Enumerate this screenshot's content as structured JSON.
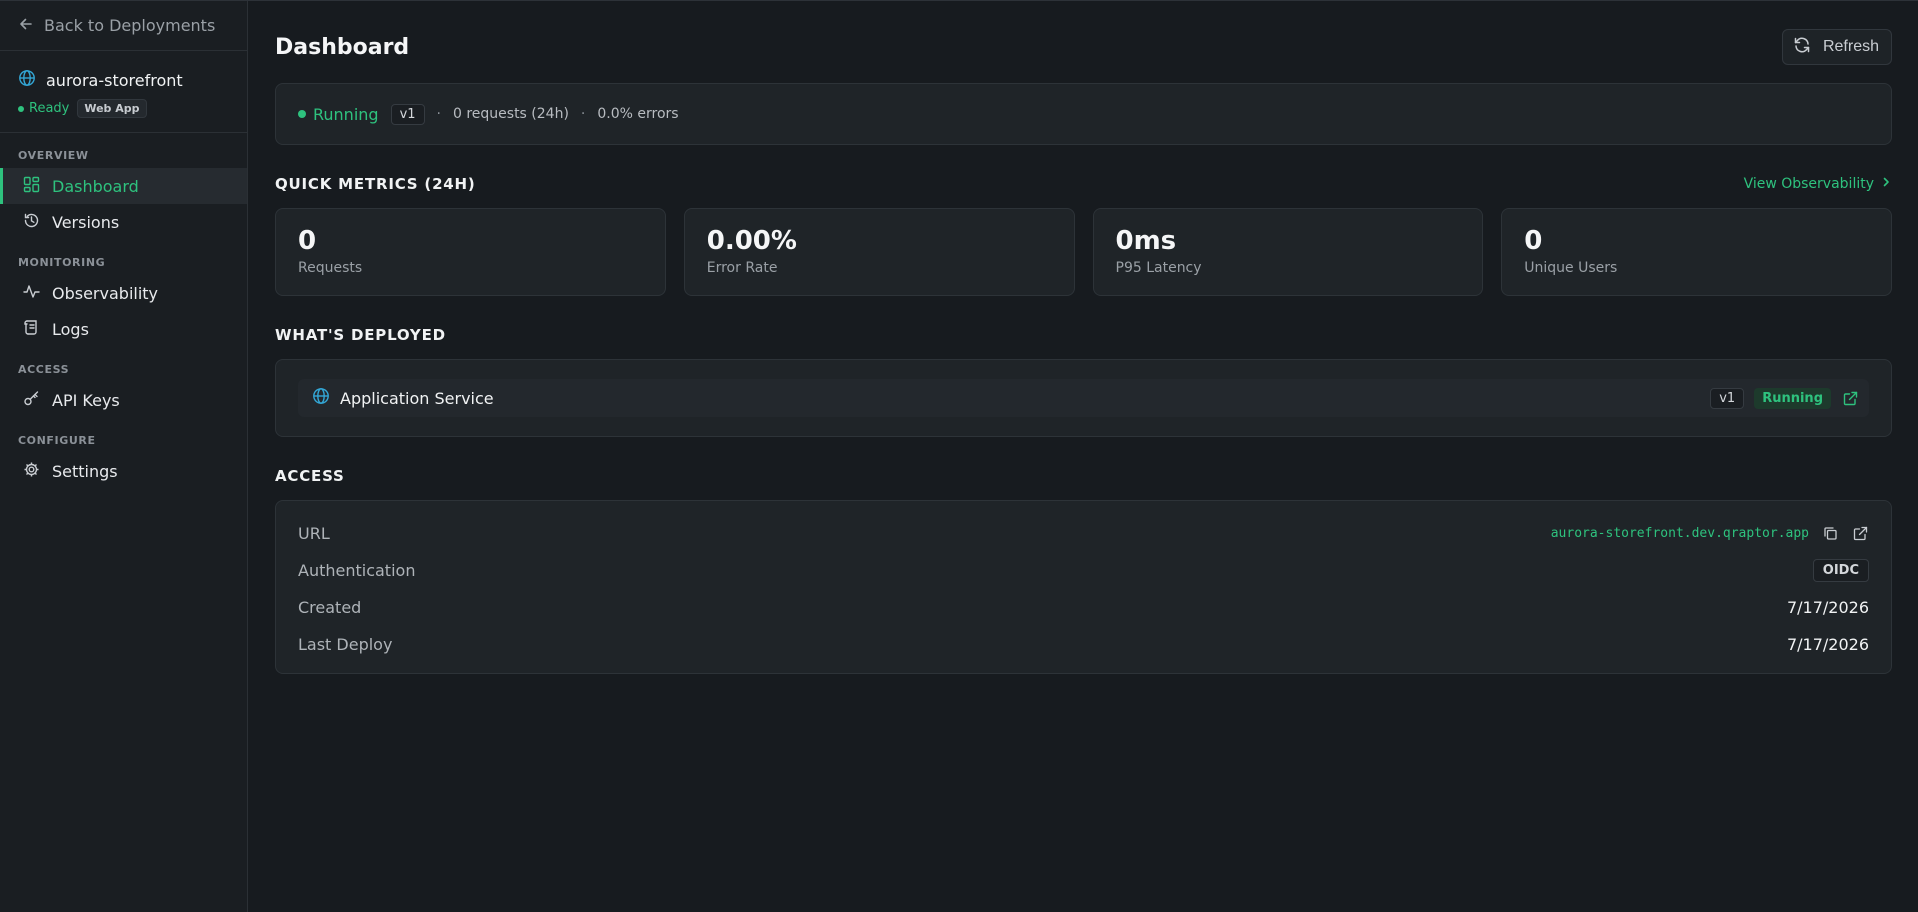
{
  "sidebar": {
    "back_label": "Back to Deployments",
    "project_name": "aurora-storefront",
    "project_status": "Ready",
    "project_type": "Web App",
    "groups": [
      {
        "heading": "OVERVIEW",
        "items": [
          {
            "label": "Dashboard",
            "icon": "dashboard-icon",
            "active": true
          },
          {
            "label": "Versions",
            "icon": "history-icon",
            "active": false
          }
        ]
      },
      {
        "heading": "MONITORING",
        "items": [
          {
            "label": "Observability",
            "icon": "activity-icon",
            "active": false
          },
          {
            "label": "Logs",
            "icon": "scroll-icon",
            "active": false
          }
        ]
      },
      {
        "heading": "ACCESS",
        "items": [
          {
            "label": "API Keys",
            "icon": "key-icon",
            "active": false
          }
        ]
      },
      {
        "heading": "CONFIGURE",
        "items": [
          {
            "label": "Settings",
            "icon": "gear-icon",
            "active": false
          }
        ]
      }
    ]
  },
  "header": {
    "title": "Dashboard",
    "refresh_label": "Refresh"
  },
  "status": {
    "state": "Running",
    "version": "v1",
    "requests": "0 requests (24h)",
    "errors": "0.0% errors"
  },
  "quick_metrics": {
    "title": "QUICK METRICS (24H)",
    "link_label": "View Observability",
    "items": [
      {
        "value": "0",
        "label": "Requests"
      },
      {
        "value": "0.00%",
        "label": "Error Rate"
      },
      {
        "value": "0ms",
        "label": "P95 Latency"
      },
      {
        "value": "0",
        "label": "Unique Users"
      }
    ]
  },
  "deployed": {
    "title": "WHAT'S DEPLOYED",
    "service_name": "Application Service",
    "version": "v1",
    "status": "Running"
  },
  "access": {
    "title": "ACCESS",
    "url_label": "URL",
    "url_value": "aurora-storefront.dev.qraptor.app",
    "auth_label": "Authentication",
    "auth_value": "OIDC",
    "created_label": "Created",
    "created_value": "7/17/2026",
    "last_deploy_label": "Last Deploy",
    "last_deploy_value": "7/17/2026"
  },
  "colors": {
    "accent": "#2ec27e",
    "globe": "#33a7d6",
    "background": "#171b1f",
    "card": "#1f2428"
  }
}
